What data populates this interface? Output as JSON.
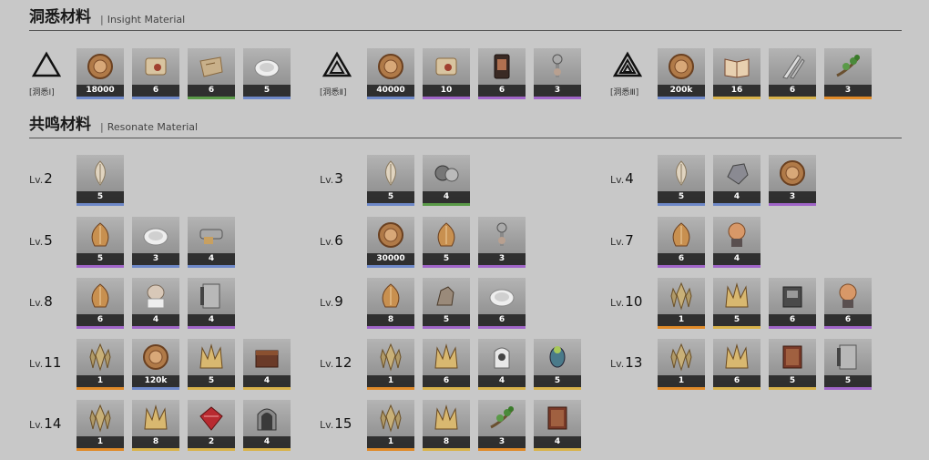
{
  "insight": {
    "title_zh": "洞悉材料",
    "title_en": "Insight Material",
    "tiers": [
      {
        "label": "[洞悉Ⅰ]",
        "items": [
          {
            "icon": "coin-icon",
            "count": "18000",
            "rarity": "blue"
          },
          {
            "icon": "scroll-icon",
            "count": "6",
            "rarity": "blue"
          },
          {
            "icon": "map-icon",
            "count": "6",
            "rarity": "green"
          },
          {
            "icon": "plate-icon",
            "count": "5",
            "rarity": "blue"
          }
        ]
      },
      {
        "label": "[洞悉Ⅱ]",
        "items": [
          {
            "icon": "coin-icon",
            "count": "40000",
            "rarity": "blue"
          },
          {
            "icon": "scroll-icon",
            "count": "10",
            "rarity": "purple"
          },
          {
            "icon": "tablet-icon",
            "count": "6",
            "rarity": "purple"
          },
          {
            "icon": "tool-icon",
            "count": "3",
            "rarity": "purple"
          }
        ]
      },
      {
        "label": "[洞悉Ⅲ]",
        "items": [
          {
            "icon": "coin-icon",
            "count": "200k",
            "rarity": "blue"
          },
          {
            "icon": "book-icon",
            "count": "16",
            "rarity": "gold"
          },
          {
            "icon": "blade-icon",
            "count": "6",
            "rarity": "gold"
          },
          {
            "icon": "branch-icon",
            "count": "3",
            "rarity": "orange"
          }
        ]
      }
    ]
  },
  "resonate": {
    "title_zh": "共鸣材料",
    "title_en": "Resonate Material",
    "levels": [
      {
        "label": "Lv.",
        "num": "2",
        "items": [
          {
            "icon": "feather-icon",
            "count": "5",
            "rarity": "blue"
          }
        ]
      },
      {
        "label": "Lv.",
        "num": "3",
        "items": [
          {
            "icon": "feather-icon",
            "count": "5",
            "rarity": "blue"
          },
          {
            "icon": "gear-icon",
            "count": "4",
            "rarity": "green"
          }
        ]
      },
      {
        "label": "Lv.",
        "num": "4",
        "items": [
          {
            "icon": "feather-icon",
            "count": "5",
            "rarity": "blue"
          },
          {
            "icon": "ore-icon",
            "count": "4",
            "rarity": "blue"
          },
          {
            "icon": "coin-icon",
            "count": "3",
            "rarity": "purple"
          }
        ]
      },
      {
        "label": "Lv.",
        "num": "5",
        "items": [
          {
            "icon": "shell-icon",
            "count": "5",
            "rarity": "purple"
          },
          {
            "icon": "plate-icon",
            "count": "3",
            "rarity": "blue"
          },
          {
            "icon": "claw-icon",
            "count": "4",
            "rarity": "blue"
          }
        ]
      },
      {
        "label": "Lv.",
        "num": "6",
        "items": [
          {
            "icon": "coin-icon",
            "count": "30000",
            "rarity": "blue"
          },
          {
            "icon": "shell-icon",
            "count": "5",
            "rarity": "purple"
          },
          {
            "icon": "tool-icon",
            "count": "3",
            "rarity": "purple"
          }
        ]
      },
      {
        "label": "Lv.",
        "num": "7",
        "items": [
          {
            "icon": "shell-icon",
            "count": "6",
            "rarity": "purple"
          },
          {
            "icon": "mask-icon",
            "count": "4",
            "rarity": "purple"
          }
        ]
      },
      {
        "label": "Lv.",
        "num": "8",
        "items": [
          {
            "icon": "shell-icon",
            "count": "6",
            "rarity": "purple"
          },
          {
            "icon": "bust-icon",
            "count": "4",
            "rarity": "purple"
          },
          {
            "icon": "slab-icon",
            "count": "4",
            "rarity": "purple"
          }
        ]
      },
      {
        "label": "Lv.",
        "num": "9",
        "items": [
          {
            "icon": "shell-icon",
            "count": "8",
            "rarity": "purple"
          },
          {
            "icon": "horse-icon",
            "count": "5",
            "rarity": "purple"
          },
          {
            "icon": "plate-icon",
            "count": "6",
            "rarity": "purple"
          }
        ]
      },
      {
        "label": "Lv.",
        "num": "10",
        "items": [
          {
            "icon": "crystal-icon",
            "count": "1",
            "rarity": "orange"
          },
          {
            "icon": "crown-icon",
            "count": "5",
            "rarity": "gold"
          },
          {
            "icon": "machine-icon",
            "count": "6",
            "rarity": "purple"
          },
          {
            "icon": "mask-icon",
            "count": "6",
            "rarity": "purple"
          }
        ]
      },
      {
        "label": "Lv.",
        "num": "11",
        "items": [
          {
            "icon": "crystal-icon",
            "count": "1",
            "rarity": "orange"
          },
          {
            "icon": "coin-icon",
            "count": "120k",
            "rarity": "blue"
          },
          {
            "icon": "crown-icon",
            "count": "5",
            "rarity": "gold"
          },
          {
            "icon": "chest-icon",
            "count": "4",
            "rarity": "gold"
          }
        ]
      },
      {
        "label": "Lv.",
        "num": "12",
        "items": [
          {
            "icon": "crystal-icon",
            "count": "1",
            "rarity": "orange"
          },
          {
            "icon": "crown-icon",
            "count": "6",
            "rarity": "gold"
          },
          {
            "icon": "relic-icon",
            "count": "4",
            "rarity": "gold"
          },
          {
            "icon": "bird-icon",
            "count": "5",
            "rarity": "gold"
          }
        ]
      },
      {
        "label": "Lv.",
        "num": "13",
        "items": [
          {
            "icon": "crystal-icon",
            "count": "1",
            "rarity": "orange"
          },
          {
            "icon": "crown-icon",
            "count": "6",
            "rarity": "gold"
          },
          {
            "icon": "tome-icon",
            "count": "5",
            "rarity": "gold"
          },
          {
            "icon": "slab-icon",
            "count": "5",
            "rarity": "purple"
          }
        ]
      },
      {
        "label": "Lv.",
        "num": "14",
        "items": [
          {
            "icon": "crystal-icon",
            "count": "1",
            "rarity": "orange"
          },
          {
            "icon": "crown-icon",
            "count": "8",
            "rarity": "gold"
          },
          {
            "icon": "gem-icon",
            "count": "2",
            "rarity": "gold"
          },
          {
            "icon": "gate-icon",
            "count": "4",
            "rarity": "gold"
          }
        ]
      },
      {
        "label": "Lv.",
        "num": "15",
        "items": [
          {
            "icon": "crystal-icon",
            "count": "1",
            "rarity": "orange"
          },
          {
            "icon": "crown-icon",
            "count": "8",
            "rarity": "gold"
          },
          {
            "icon": "branch-icon",
            "count": "3",
            "rarity": "orange"
          },
          {
            "icon": "tome-icon",
            "count": "4",
            "rarity": "gold"
          }
        ]
      }
    ]
  }
}
